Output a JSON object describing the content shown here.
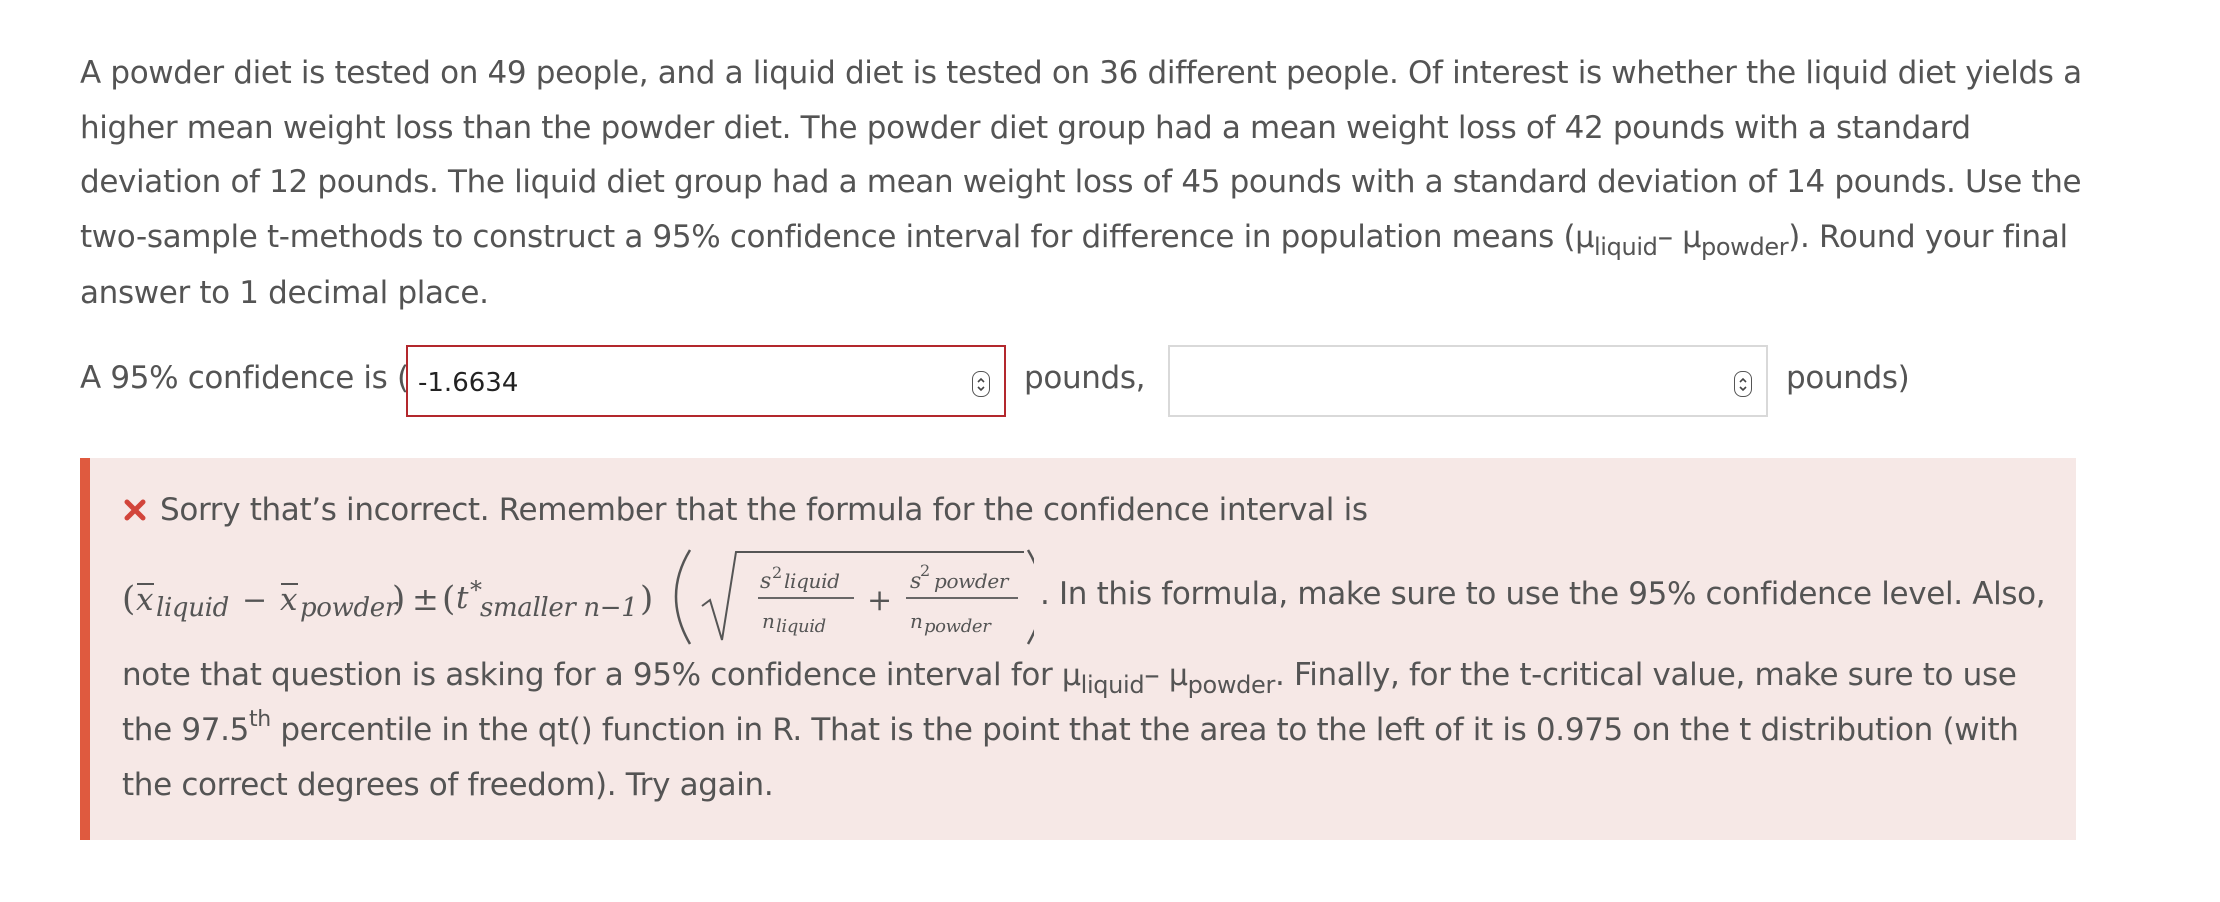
{
  "question": {
    "line1": "A powder diet is tested on 49 people, and a liquid diet is tested on 36 different people. Of interest is whether the liquid diet yields a",
    "line2": "higher mean weight loss than the powder diet. The powder diet group had a mean weight loss of 42 pounds with a standard",
    "line3": "deviation of 12 pounds. The liquid diet group had a mean weight loss of 45 pounds with a standard deviation of 14 pounds. Use the",
    "line4_start": "two-sample t-methods to construct a 95% confidence interval for difference in population means (",
    "mu": "μ",
    "sub_liquid": "liquid",
    "minus": "– ",
    "sub_powder": "powder",
    "line4_end": "). Round your final",
    "line5": "answer to 1 decimal place."
  },
  "answer": {
    "prefix": "A 95% confidence is (",
    "lower_value": "-1.6634",
    "unit1": "pounds,",
    "upper_value": "",
    "unit2": "pounds)"
  },
  "feedback": {
    "line1": "Sorry that’s incorrect. Remember that the formula for the confidence interval is",
    "formula_after": ". In this formula, make sure to use the 95% confidence level. Also,",
    "line3_start": "note that question is asking for a 95% confidence interval for ",
    "line3_end": ". Finally, for the t-critical value, make sure to use",
    "line4_start": "the 97.5",
    "line4_sup": "th",
    "line4_end": " percentile in the qt() function in R. That is the point that the area to the left of it is 0.975 on the t distribution (with",
    "line5": "the correct degrees of freedom). Try again.",
    "math": {
      "xbar_liquid": "liquid",
      "xbar_powder": "powder",
      "t_sub": "smaller n−1",
      "s_liquid": "liquid",
      "n_liquid": "liquid",
      "s_powder": "powder",
      "n_powder": "powder"
    }
  },
  "colors": {
    "text": "#545454",
    "invalid_border": "#b3282d",
    "feedback_bg": "#f6e8e6",
    "feedback_bar": "#df5a3f",
    "x_icon": "#d2453b"
  },
  "icons": {
    "stepper": "up-down-stepper-icon",
    "incorrect": "x-mark-icon"
  }
}
